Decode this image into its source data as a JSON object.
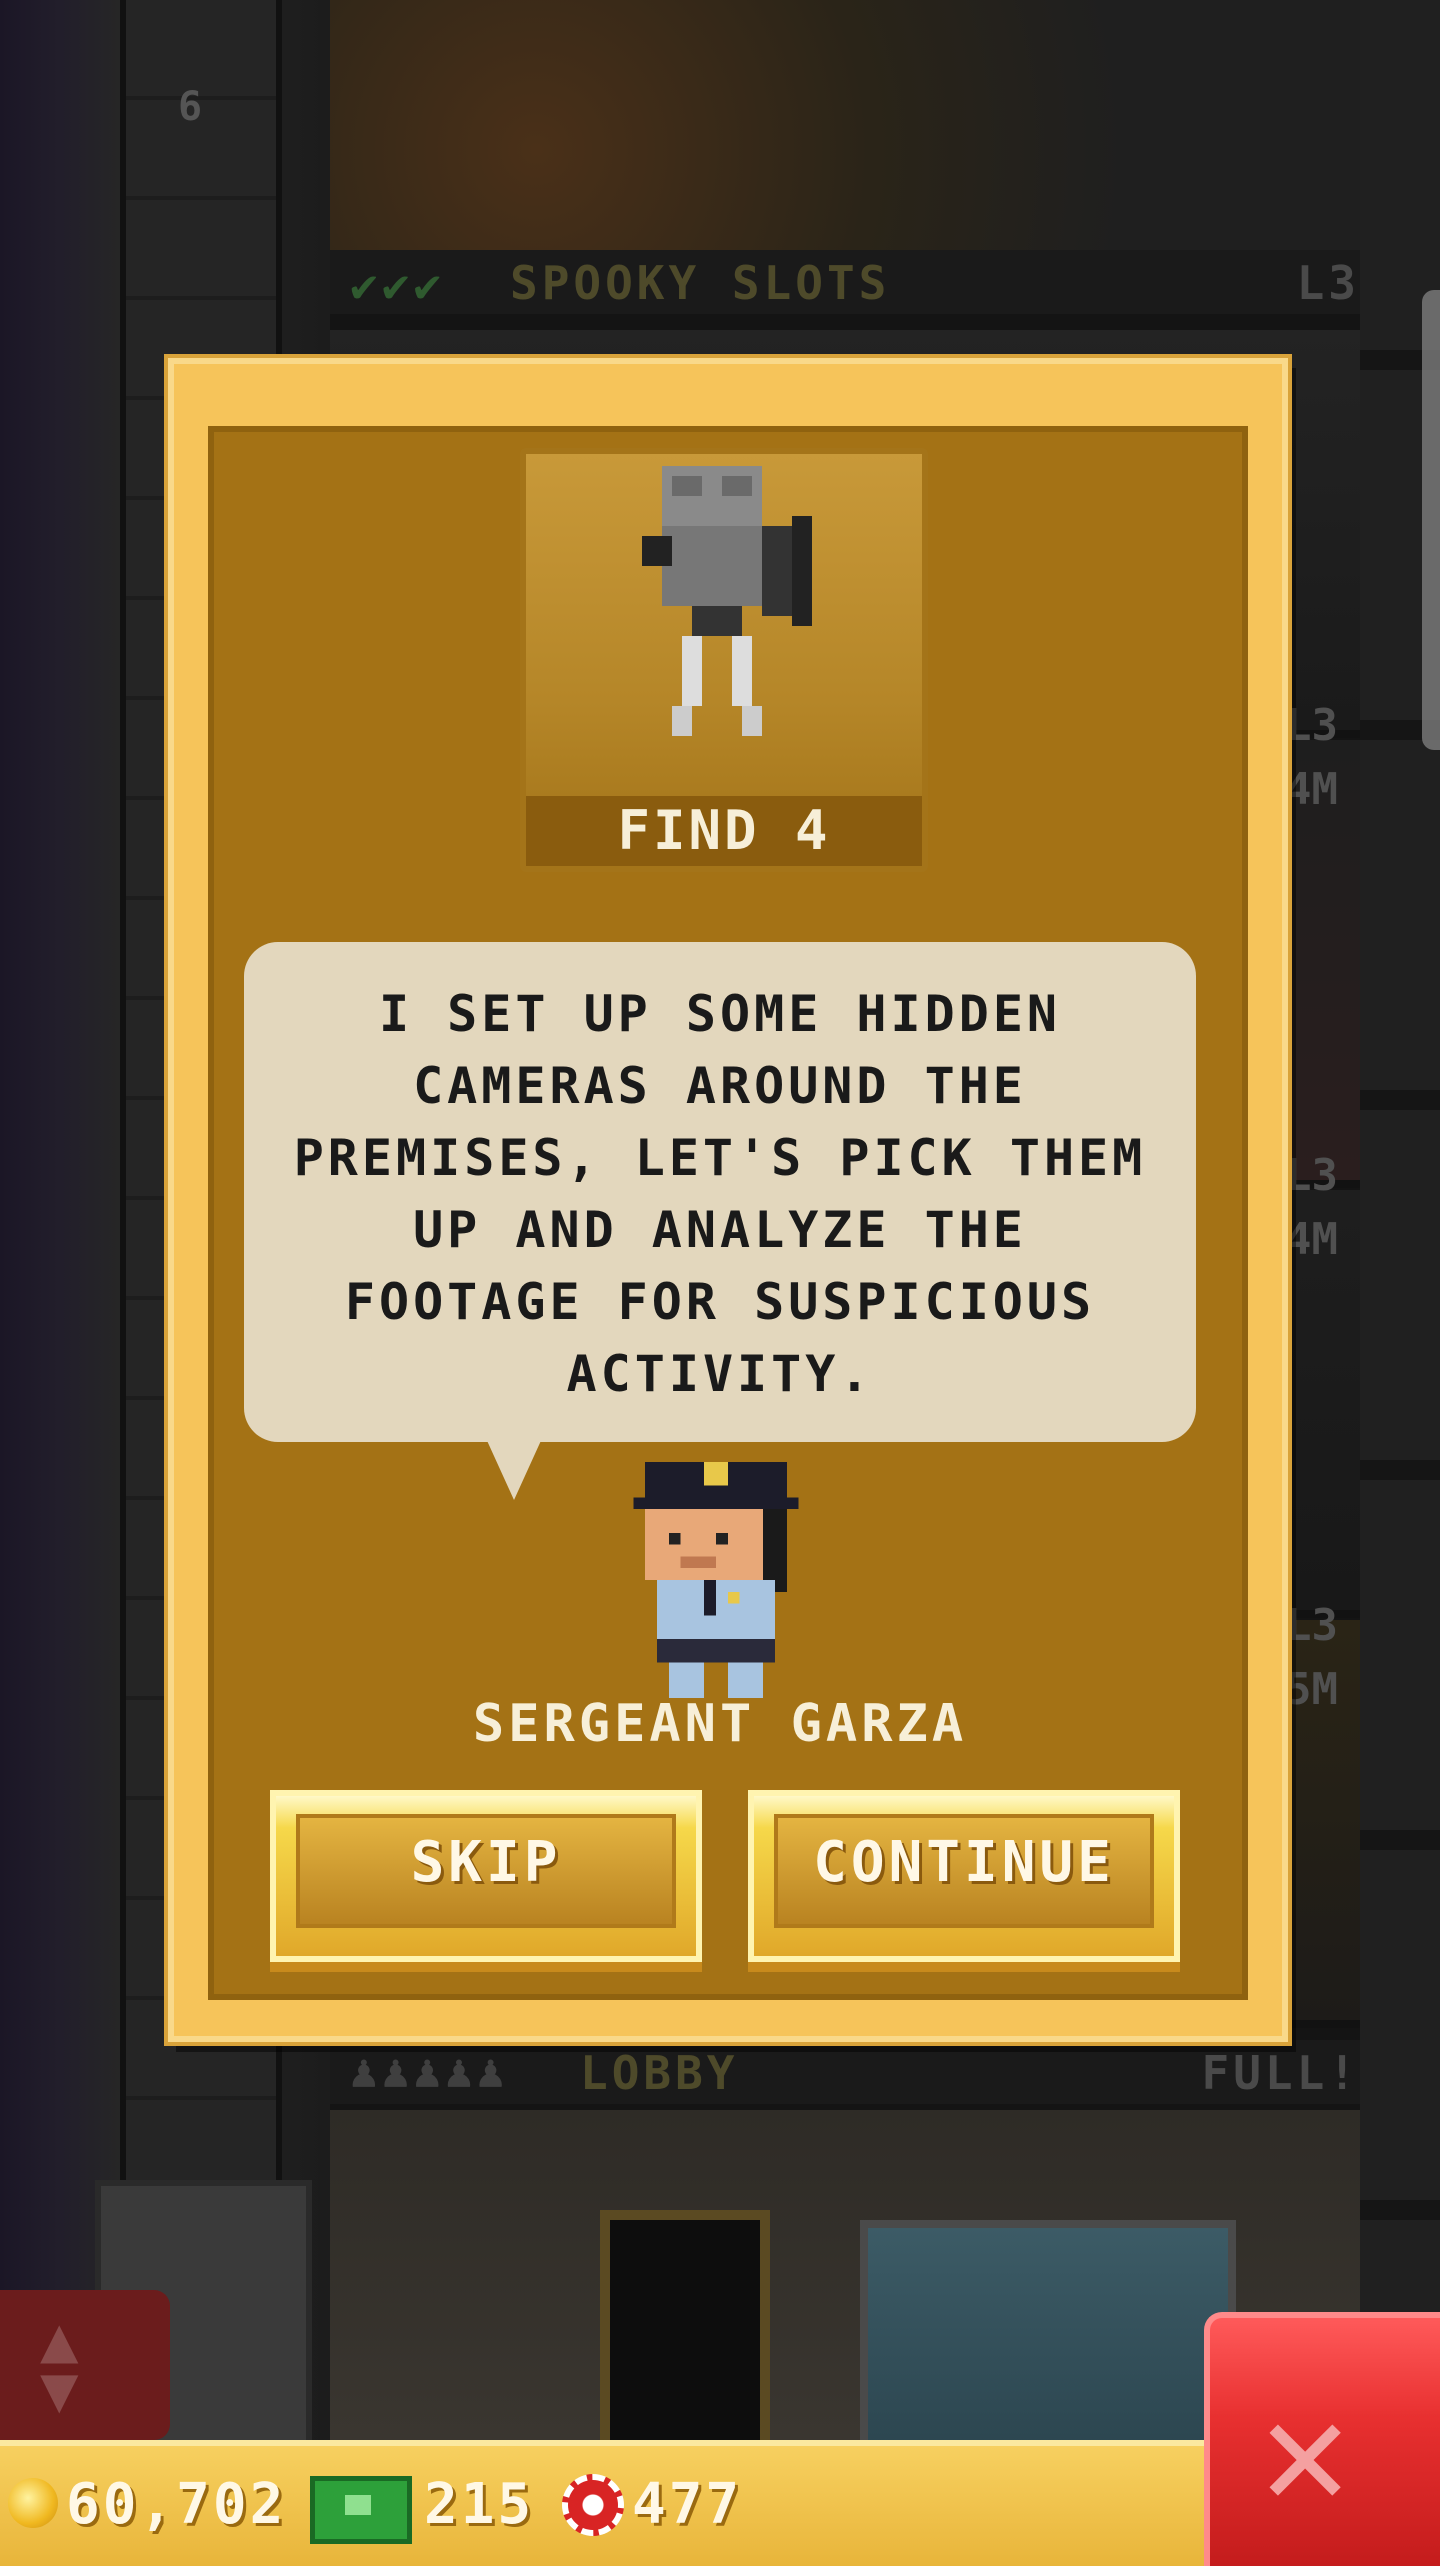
{
  "background": {
    "floor_number": "6",
    "top_floor": {
      "checks": "✔✔✔",
      "name": "SPOOKY SLOTS",
      "level": "L3"
    },
    "side_levels": [
      "L3",
      "4M",
      "L3",
      "4M",
      "L3",
      "5M"
    ],
    "lobby": {
      "people": "♟♟♟♟♟",
      "name": "LOBBY",
      "status": "FULL!"
    }
  },
  "dialog": {
    "item_label": "FIND 4",
    "message": "I SET UP SOME HIDDEN CAMERAS AROUND THE PREMISES, LET'S PICK THEM UP AND ANALYZE THE FOOTAGE FOR SUSPICIOUS ACTIVITY.",
    "speaker": "SERGEANT GARZA",
    "skip_label": "SKIP",
    "continue_label": "CONTINUE"
  },
  "hud": {
    "coins": "60,702",
    "bux": "215",
    "chips": "477"
  },
  "colors": {
    "dialog_frame": "#f6c45a",
    "dialog_inner": "#a47215",
    "bubble": "#e3d7bd",
    "close_button": "#e83030",
    "cash_green": "#2da03a"
  }
}
